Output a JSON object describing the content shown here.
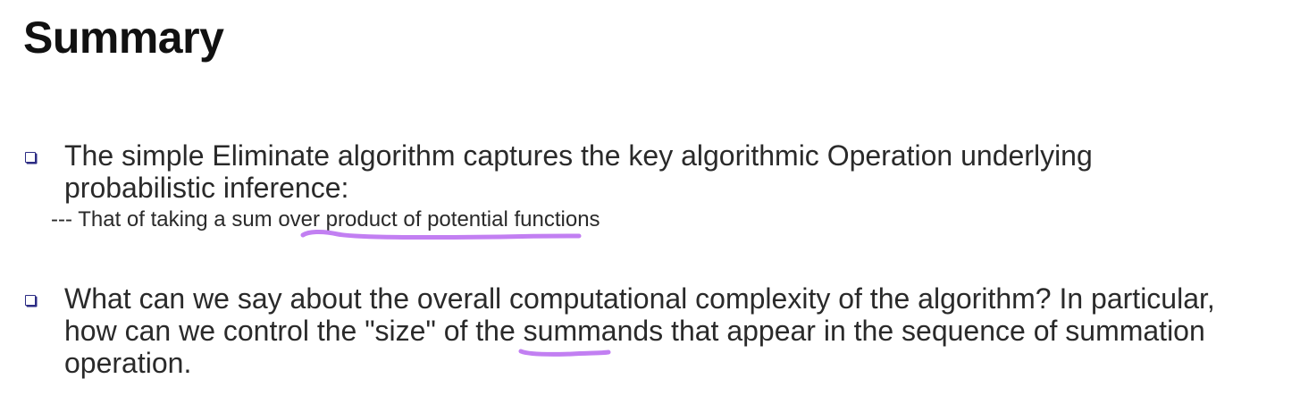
{
  "slide": {
    "title": "Summary",
    "bullets": [
      {
        "text": "The simple Eliminate algorithm captures the key algorithmic Operation underlying probabilistic inference:",
        "sub": "--- That of taking a sum over product of potential functions"
      },
      {
        "text": "What can we say about the overall computational complexity of the algorithm? In particular, how can we control the \"size\" of the summands that appear in the sequence of summation operation."
      }
    ]
  },
  "colors": {
    "highlight": "#c27ff2",
    "bullet_marker": "#2c2c84",
    "title": "#111111",
    "text": "#2a2a2a"
  },
  "icons": {
    "bullet": "square-bullet-icon"
  }
}
